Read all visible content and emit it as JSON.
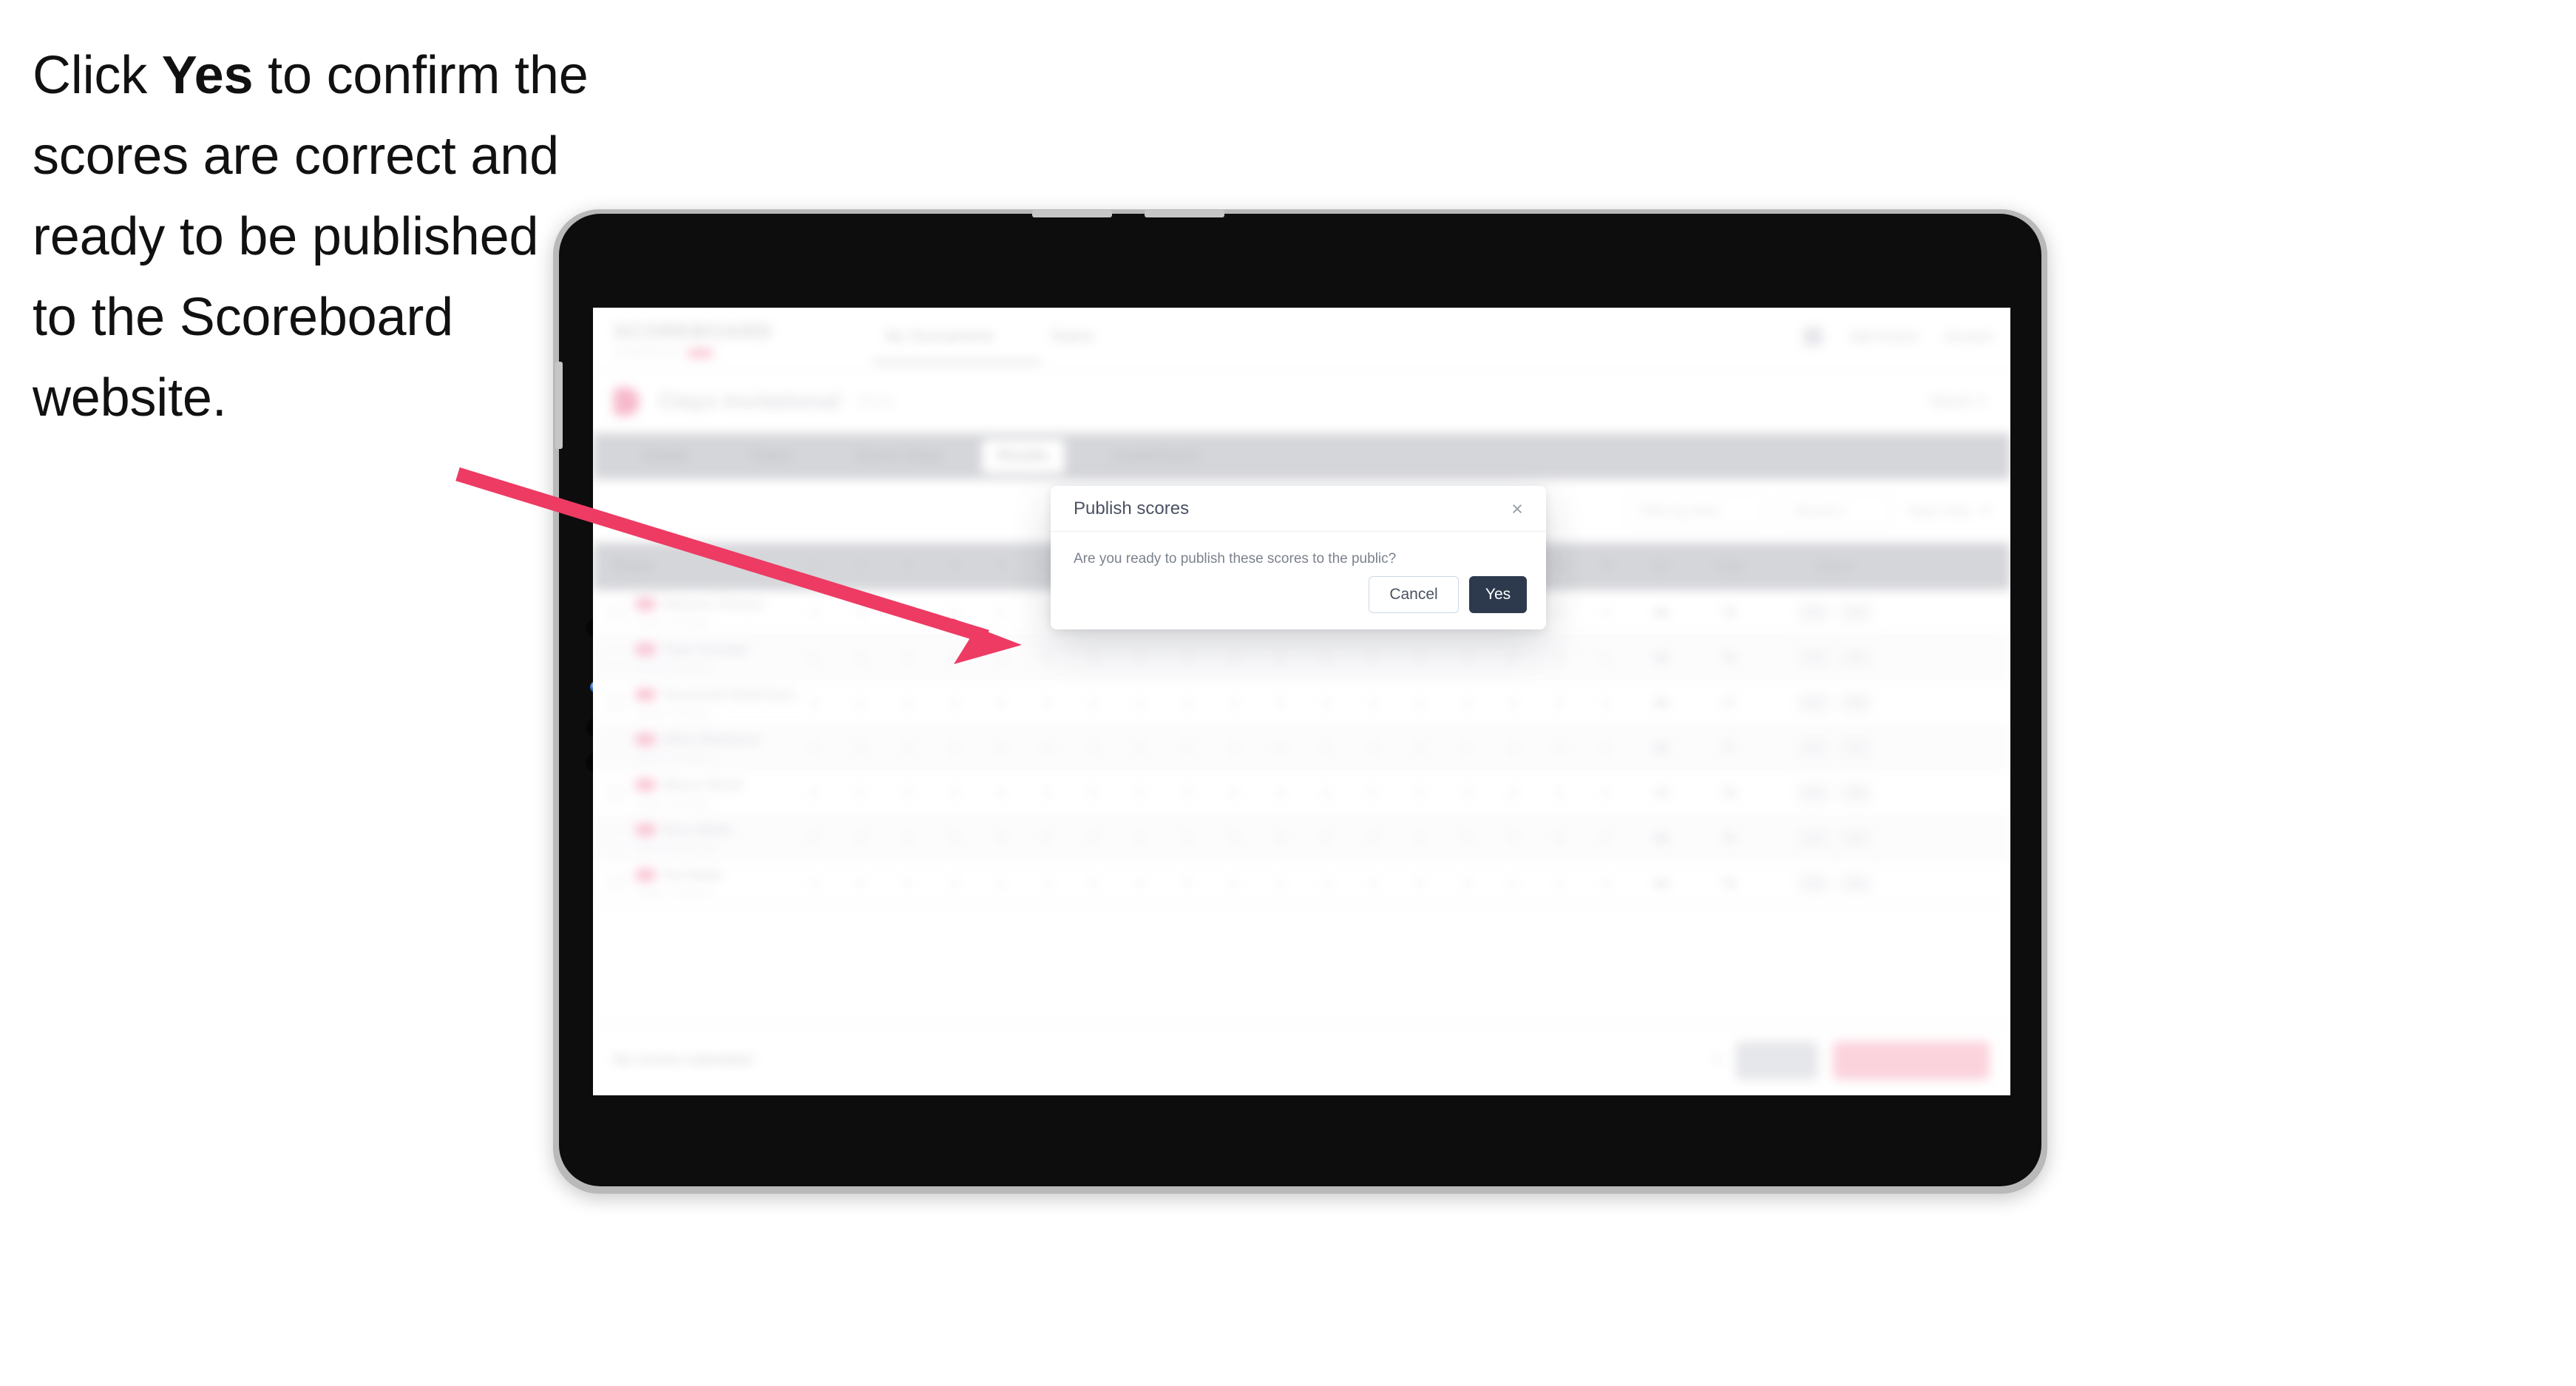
{
  "caption": {
    "before": "Click ",
    "emphasis": "Yes",
    "after": " to confirm the scores are correct and ready to be published to the Scoreboard website."
  },
  "annotation": {
    "arrow_color": "#ED3B63",
    "arrow_name": "pointer-arrow"
  },
  "device": {
    "type": "tablet",
    "frame_color": "#b9b9b9",
    "bezel_color": "#0d0d0d"
  },
  "app": {
    "header": {
      "brand": "SCOREBOARD",
      "brand_sub": "POWERED BY",
      "nav": [
        "My Tournaments",
        "Teams"
      ],
      "right_items": [
        "Add Scores",
        "Account"
      ]
    },
    "event": {
      "title": "Clays Invitational",
      "subtitle": "2024",
      "right_label": "Week 3"
    },
    "tabs": [
      {
        "label": "Details",
        "active": false
      },
      {
        "label": "Teams",
        "active": false
      },
      {
        "label": "Scorer Setup",
        "active": false
      },
      {
        "label": "Results",
        "active": true
      },
      {
        "label": "Leaderboard",
        "active": false
      }
    ],
    "toolbar": {
      "filters": [
        "Filter by team",
        "Round 1",
        "Team Only"
      ]
    },
    "table": {
      "first_column": "Player",
      "hole_columns": [
        "1",
        "2",
        "3",
        "4",
        "5",
        "6",
        "7",
        "8",
        "9",
        "10",
        "11",
        "12",
        "13",
        "14",
        "15",
        "16",
        "17",
        "18"
      ],
      "tail_columns": [
        "R1",
        "Total",
        "Status"
      ],
      "rows": [
        {
          "name": "Dawson Ferrara",
          "sub": "Team 1 Group 1",
          "holes": [
            "0",
            "0",
            "0",
            "0",
            "0",
            "0",
            "0",
            "0",
            "0",
            "0",
            "0",
            "0",
            "0",
            "0",
            "0",
            "0",
            "0",
            "0"
          ],
          "r1": "68",
          "total": "76",
          "tag_a": "100",
          "tag_b": "100"
        },
        {
          "name": "Piper Kendall",
          "sub": "Team 2 Group 1",
          "holes": [
            "0",
            "0",
            "0",
            "0",
            "0",
            "0",
            "0",
            "0",
            "0",
            "0",
            "0",
            "0",
            "0",
            "0",
            "0",
            "0",
            "0",
            "0"
          ],
          "r1": "69",
          "total": "74",
          "tag_a": "100",
          "tag_b": "100"
        },
        {
          "name": "Savannah Robertson",
          "sub": "Team 3 Group 1",
          "holes": [
            "0",
            "0",
            "0",
            "0",
            "0",
            "0",
            "0",
            "0",
            "0",
            "0",
            "0",
            "0",
            "0",
            "0",
            "0",
            "0",
            "0",
            "0"
          ],
          "r1": "66",
          "total": "77",
          "tag_a": "100",
          "tag_b": "100"
        },
        {
          "name": "Elliot Whitmore",
          "sub": "Team 1 Group 2",
          "holes": [
            "0",
            "0",
            "0",
            "0",
            "0",
            "0",
            "0",
            "0",
            "0",
            "0",
            "0",
            "0",
            "0",
            "0",
            "0",
            "0",
            "0",
            "0"
          ],
          "r1": "66",
          "total": "77",
          "tag_a": "100",
          "tag_b": "100"
        },
        {
          "name": "Mason Brant",
          "sub": "Team 2 Group 2",
          "holes": [
            "0",
            "0",
            "0",
            "0",
            "0",
            "0",
            "0",
            "0",
            "0",
            "0",
            "0",
            "0",
            "0",
            "0",
            "0",
            "0",
            "0",
            "0"
          ],
          "r1": "70",
          "total": "79",
          "tag_a": "100",
          "tag_b": "100"
        },
        {
          "name": "Nora Webb",
          "sub": "Team 3 Group 2",
          "holes": [
            "0",
            "0",
            "0",
            "0",
            "0",
            "0",
            "0",
            "0",
            "0",
            "0",
            "0",
            "0",
            "0",
            "0",
            "0",
            "0",
            "0",
            "0"
          ],
          "r1": "68",
          "total": "75",
          "tag_a": "100",
          "tag_b": "100"
        },
        {
          "name": "Kai Nakai",
          "sub": "Team 1 Group 3",
          "holes": [
            "0",
            "0",
            "0",
            "0",
            "0",
            "0",
            "0",
            "0",
            "0",
            "0",
            "0",
            "0",
            "0",
            "0",
            "0",
            "0",
            "0",
            "0"
          ],
          "r1": "68",
          "total": "76",
          "tag_a": "100",
          "tag_b": "100"
        }
      ]
    },
    "bottom_bar": {
      "status": "No scores submitted",
      "count": "0",
      "secondary_button": "Save",
      "primary_button": "Publish scores"
    }
  },
  "modal": {
    "title": "Publish scores",
    "body": "Are you ready to publish these scores to the public?",
    "cancel_label": "Cancel",
    "confirm_label": "Yes",
    "close_icon": "×",
    "confirm_color": "#2d3a4e"
  }
}
